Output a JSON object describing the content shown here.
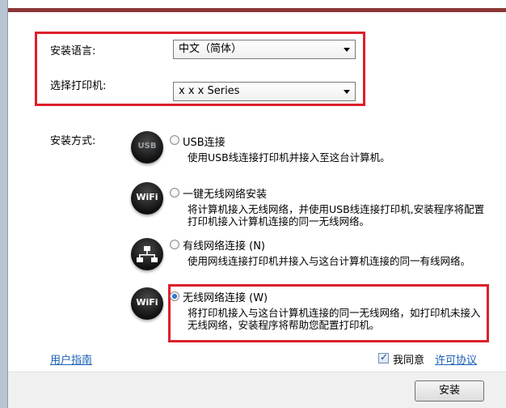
{
  "settings": {
    "language_label": "安装语言:",
    "language_value": "中文（简体）",
    "printer_label": "选择打印机:",
    "printer_value": "x x x Series"
  },
  "install_mode_label": "安装方式:",
  "options": [
    {
      "title": "USB连接",
      "desc": "使用USB线连接打印机并接入至这台计算机。",
      "icon": "usb-icon",
      "icon_text": "USB",
      "checked": false
    },
    {
      "title": "一键无线网络安装",
      "desc": "将计算机接入无线网络，并使用USB线连接打印机,安装程序将配置打印机接入计算机连接的同一无线网络。",
      "icon": "wifi-icon",
      "icon_text": "WiFi",
      "checked": false
    },
    {
      "title": "有线网络连接 (N)",
      "desc": "使用网线连接打印机并接入与这台计算机连接的同一有线网络。",
      "icon": "wired-network-icon",
      "icon_text": "",
      "checked": false
    },
    {
      "title": "无线网络连接 (W)",
      "desc": "将打印机接入与这台计算机连接的同一无线网络，如打印机未接入无线网络，安装程序将帮助您配置打印机。",
      "icon": "wifi-icon",
      "icon_text": "WiFi",
      "checked": true
    }
  ],
  "footer": {
    "user_guide_link": "用户指南",
    "agree_prefix": "我同意",
    "license_link": "许可协议",
    "agree_checked": true,
    "install_button": "安装"
  },
  "colors": {
    "highlight": "#dd1f2b",
    "link": "#1a5fb4",
    "title_strip": "#8a3636"
  }
}
